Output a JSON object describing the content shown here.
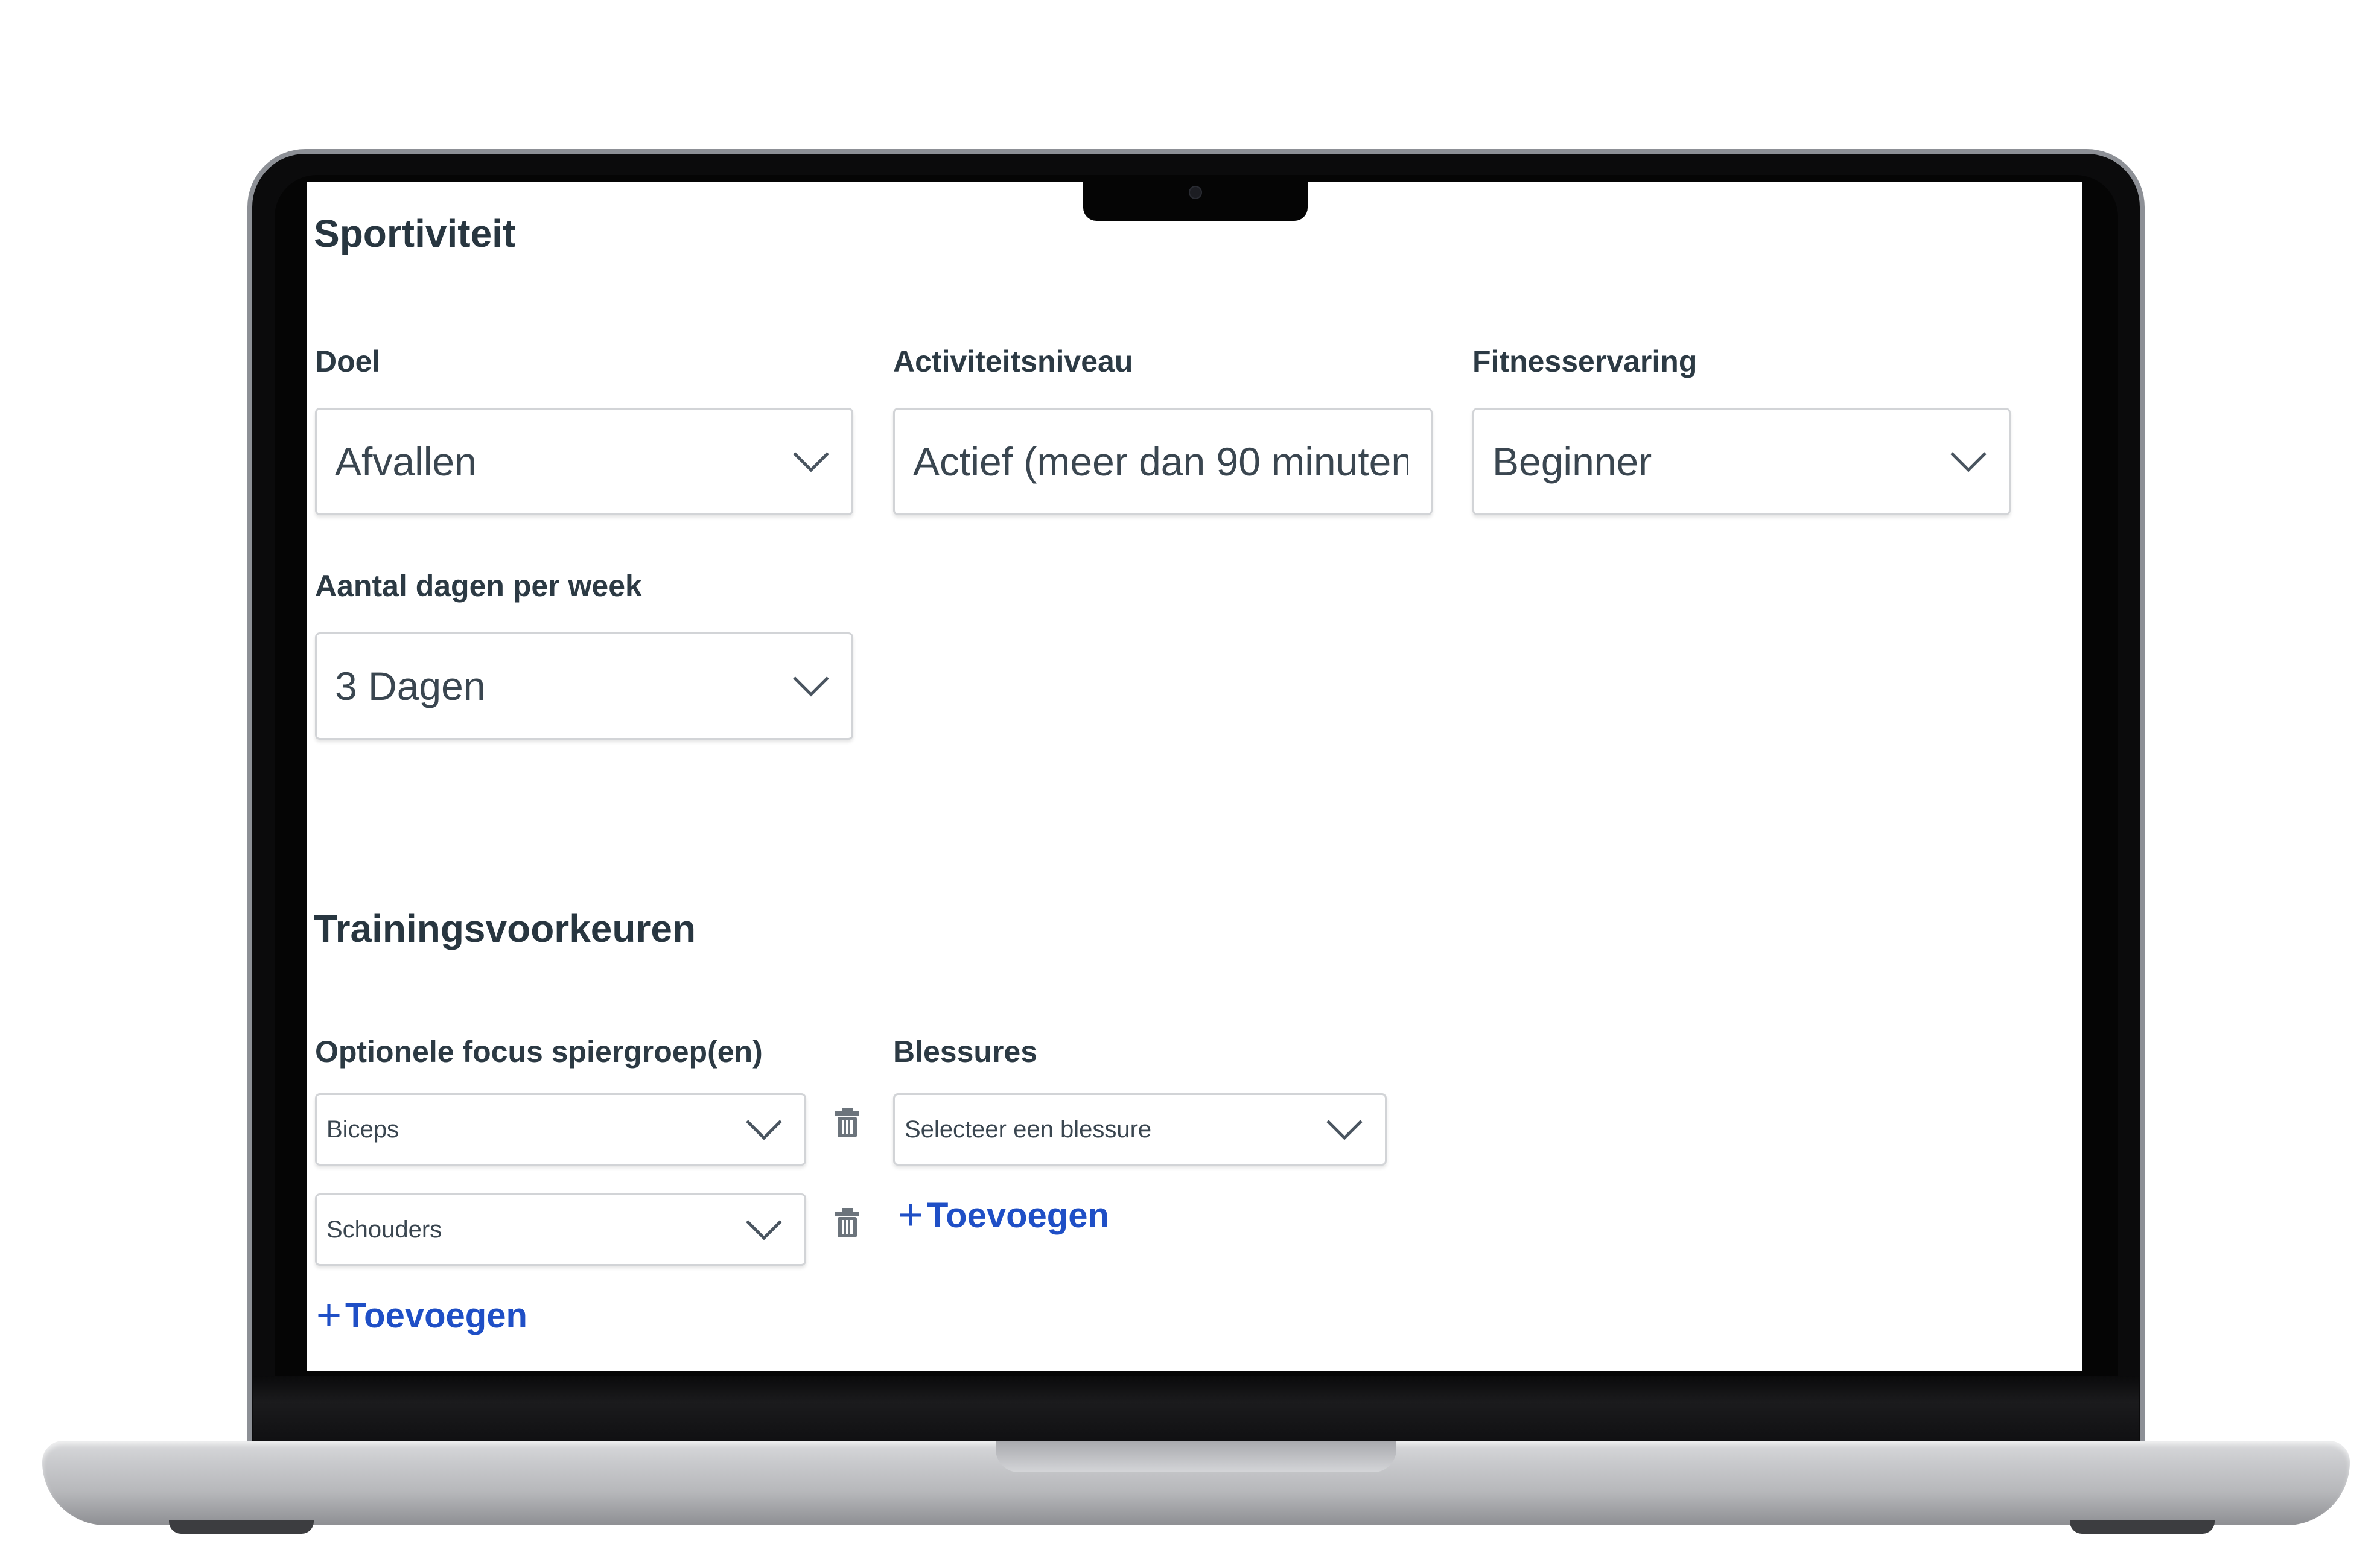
{
  "sportiviteit": {
    "title": "Sportiviteit",
    "doel": {
      "label": "Doel",
      "value": "Afvallen"
    },
    "activiteitsniveau": {
      "label": "Activiteitsniveau",
      "value": "Actief (meer dan 90 minuten"
    },
    "fitnesservaring": {
      "label": "Fitnesservaring",
      "value": "Beginner"
    },
    "dagen": {
      "label": "Aantal dagen per week",
      "value": "3 Dagen"
    }
  },
  "trainingsvoorkeuren": {
    "title": "Trainingsvoorkeuren",
    "focus": {
      "label": "Optionele focus spiergroep(en)",
      "items": [
        "Biceps",
        "Schouders"
      ],
      "add_label": "Toevoegen"
    },
    "blessures": {
      "label": "Blessures",
      "placeholder": "Selecteer een blessure",
      "add_label": "Toevoegen"
    }
  },
  "icons": {
    "dropdown": "chevron-down-icon",
    "delete": "trash-icon",
    "add": "plus-icon"
  },
  "colors": {
    "link": "#1f4fc6",
    "heading": "#283640"
  }
}
